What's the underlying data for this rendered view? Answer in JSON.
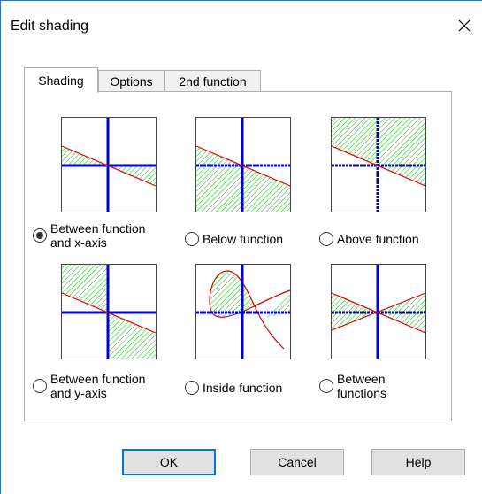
{
  "window": {
    "title": "Edit shading",
    "close_glyph": "✕",
    "accent_color": "#2b73c8"
  },
  "tabs": [
    {
      "label": "Shading",
      "active": true
    },
    {
      "label": "Options",
      "active": false
    },
    {
      "label": "2nd function",
      "active": false
    }
  ],
  "options": [
    {
      "id": "between-function-x-axis",
      "line1": "Between function",
      "line2": "and x-axis",
      "selected": true,
      "preview_icon": "shade-between-function-x-axis"
    },
    {
      "id": "below-function",
      "line1": "Below function",
      "line2": "",
      "selected": false,
      "preview_icon": "shade-below-function"
    },
    {
      "id": "above-function",
      "line1": "Above function",
      "line2": "",
      "selected": false,
      "preview_icon": "shade-above-function"
    },
    {
      "id": "between-function-y-axis",
      "line1": "Between function",
      "line2": "and y-axis",
      "selected": false,
      "preview_icon": "shade-between-function-y-axis"
    },
    {
      "id": "inside-function",
      "line1": "Inside function",
      "line2": "",
      "selected": false,
      "preview_icon": "shade-inside-function"
    },
    {
      "id": "between-functions",
      "line1": "Between",
      "line2": "functions",
      "selected": false,
      "preview_icon": "shade-between-functions"
    }
  ],
  "buttons": {
    "ok": "OK",
    "cancel": "Cancel",
    "help": "Help"
  },
  "colors": {
    "axis": "#0000cc",
    "function": "#e00000",
    "shade": "#00c000"
  }
}
